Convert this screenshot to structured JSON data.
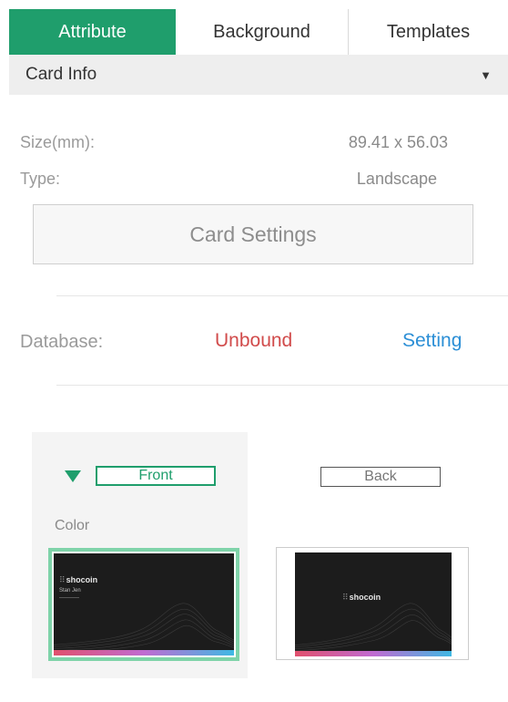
{
  "tabs": [
    {
      "label": "Attribute",
      "active": true
    },
    {
      "label": "Background",
      "active": false
    },
    {
      "label": "Templates",
      "active": false
    }
  ],
  "section": {
    "title": "Card Info",
    "caret": "▼"
  },
  "card_info": {
    "size_label": "Size(mm):",
    "size_value": "89.41 x 56.03",
    "type_label": "Type:",
    "type_value": "Landscape",
    "settings_button": "Card Settings"
  },
  "database": {
    "label": "Database:",
    "status": "Unbound",
    "setting_link": "Setting"
  },
  "card_sides": {
    "front_label": "Front",
    "back_label": "Back",
    "color_label": "Color"
  },
  "thumbnails": {
    "front_brand_dots": "⠿",
    "front_brand": "shocoin",
    "front_name": "Stan Jen",
    "back_brand_dots": "⠿",
    "back_brand": "shocoin"
  },
  "colors": {
    "accent": "#1f9e6c",
    "unbound": "#d14b4b",
    "link": "#2c8fd6",
    "selected_border": "#7fd3a9"
  }
}
